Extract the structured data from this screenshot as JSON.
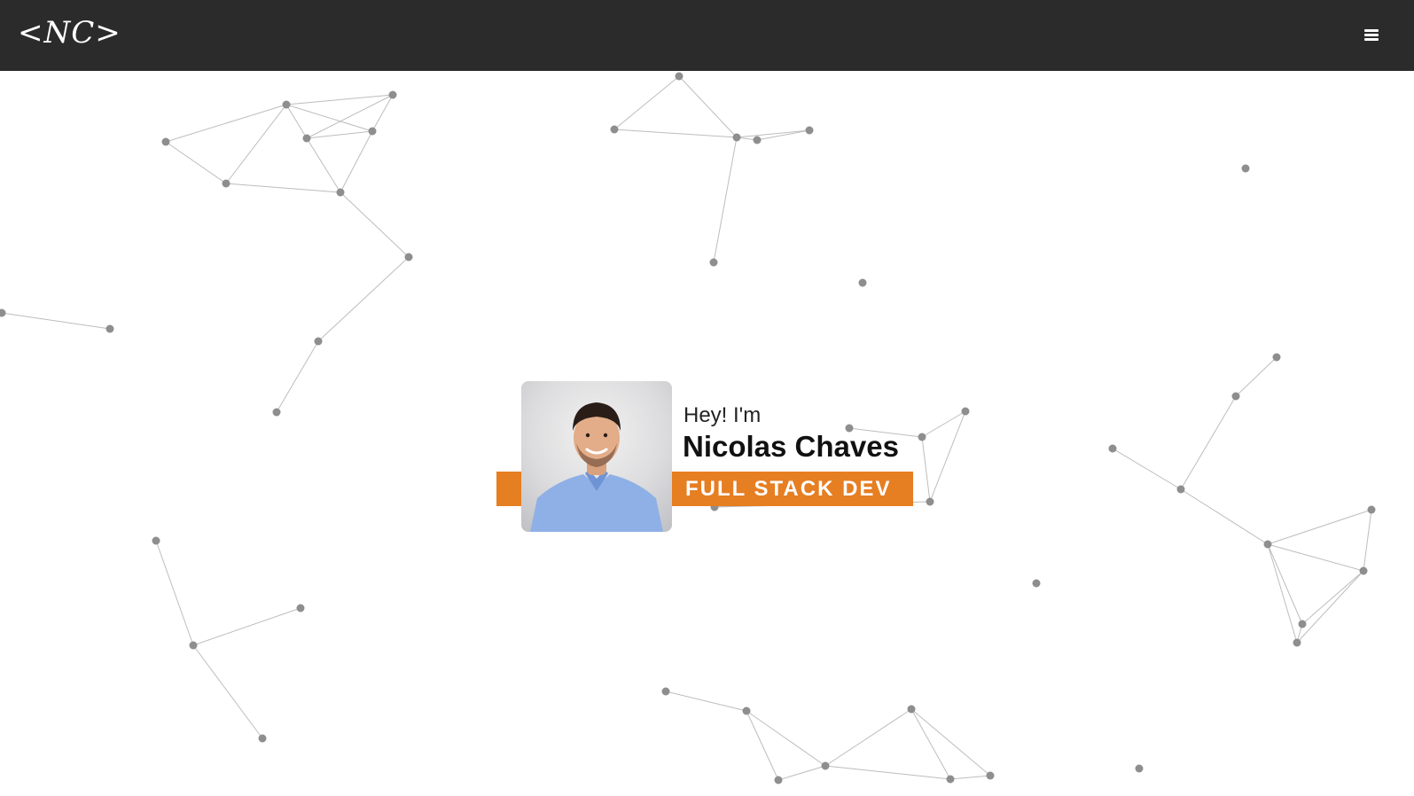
{
  "header": {
    "logo_text": "<NC>",
    "menu_icon": "hamburger-menu-icon",
    "background_color": "#2b2b2b"
  },
  "hero": {
    "greeting": "Hey! I'm",
    "name": "Nicolas Chaves",
    "role": "FULL STACK DEV",
    "accent_color": "#e67e22",
    "photo": "profile-photo"
  },
  "background": {
    "type": "particle-network",
    "node_color": "#8e8e8e",
    "line_color": "#bdbdbd"
  }
}
